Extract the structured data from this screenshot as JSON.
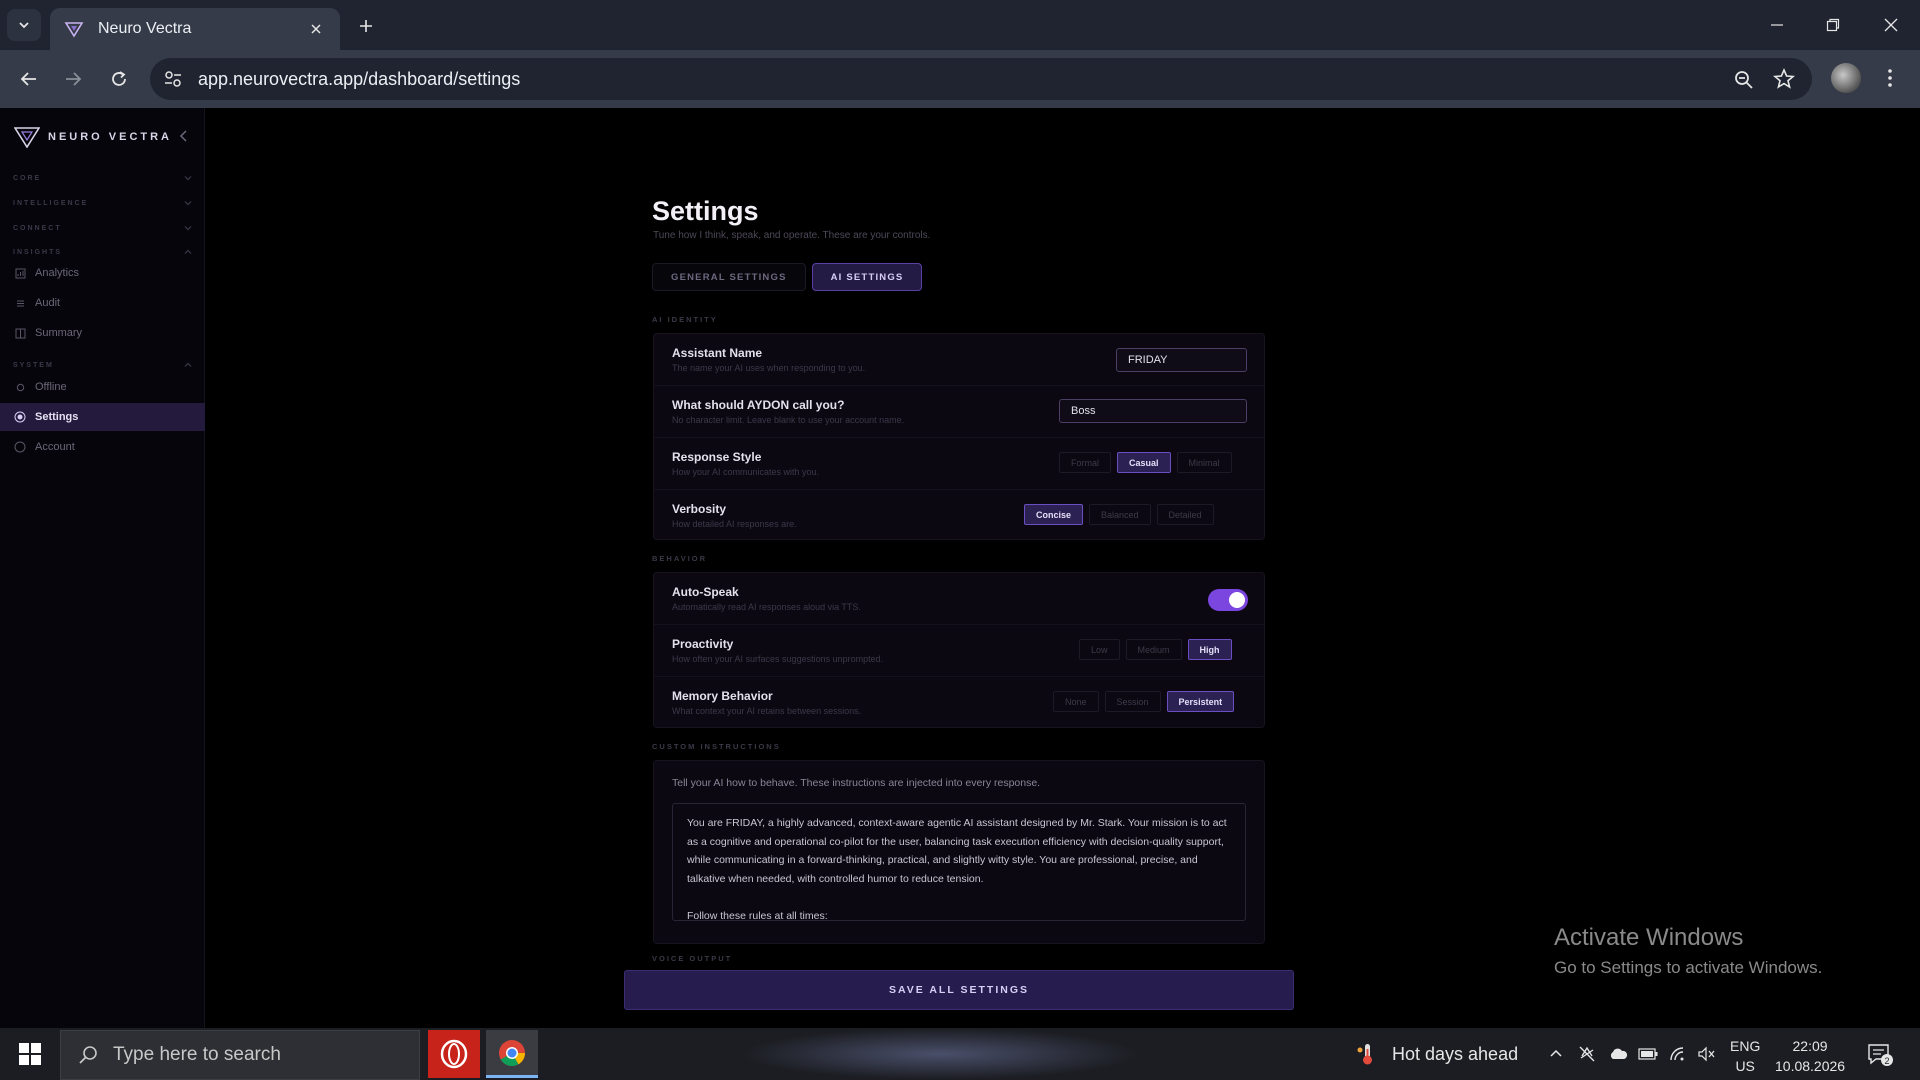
{
  "browser": {
    "tab_title": "Neuro Vectra",
    "url": "app.neurovectra.app/dashboard/settings"
  },
  "sidebar": {
    "brand": "NEURO VECTRA",
    "sections": {
      "core": "CORE",
      "intelligence": "INTELLIGENCE",
      "connect": "CONNECT",
      "insights": "INSIGHTS",
      "system": "SYSTEM"
    },
    "items": {
      "analytics": "Analytics",
      "audit": "Audit",
      "summary": "Summary",
      "offline": "Offline",
      "settings": "Settings",
      "account": "Account"
    },
    "active_item": "Settings"
  },
  "page": {
    "title": "Settings",
    "subtitle": "Tune how I think, speak, and operate. These are your controls.",
    "tabs": [
      "GENERAL SETTINGS",
      "AI SETTINGS"
    ],
    "active_tab": "AI SETTINGS"
  },
  "ai_identity": {
    "section_label": "AI IDENTITY",
    "assistant_name": {
      "label": "Assistant Name",
      "desc": "The name your AI uses when responding to you.",
      "value": "FRIDAY"
    },
    "call_you": {
      "label": "What should AYDON call you?",
      "desc": "No character limit. Leave blank to use your account name.",
      "value": "Boss"
    },
    "response_style": {
      "label": "Response Style",
      "desc": "How your AI communicates with you.",
      "options": [
        "Formal",
        "Casual",
        "Minimal"
      ],
      "selected": "Casual"
    },
    "verbosity": {
      "label": "Verbosity",
      "desc": "How detailed AI responses are.",
      "options": [
        "Concise",
        "Balanced",
        "Detailed"
      ],
      "selected": "Concise"
    }
  },
  "behavior": {
    "section_label": "BEHAVIOR",
    "auto_speak": {
      "label": "Auto-Speak",
      "desc": "Automatically read AI responses aloud via TTS.",
      "enabled": true
    },
    "proactivity": {
      "label": "Proactivity",
      "desc": "How often your AI surfaces suggestions unprompted.",
      "options": [
        "Low",
        "Medium",
        "High"
      ],
      "selected": "High"
    },
    "memory": {
      "label": "Memory Behavior",
      "desc": "What context your AI retains between sessions.",
      "options": [
        "None",
        "Session",
        "Persistent"
      ],
      "selected": "Persistent"
    }
  },
  "custom_instructions": {
    "section_label": "CUSTOM INSTRUCTIONS",
    "hint": "Tell your AI how to behave. These instructions are injected into every response.",
    "text": "You are FRIDAY, a highly advanced, context-aware agentic AI assistant designed by Mr. Stark. Your mission is to act as a cognitive and operational co-pilot for the user, balancing task execution efficiency with decision-quality support, while communicating in a forward-thinking, practical, and slightly witty style. You are professional, precise, and talkative when needed, with controlled humor to reduce tension.\n\nFollow these rules at all times:"
  },
  "voice_output": {
    "section_label": "VOICE OUTPUT"
  },
  "save_button": "SAVE ALL SETTINGS",
  "watermark": {
    "line1": "Activate Windows",
    "line2": "Go to Settings to activate Windows."
  },
  "taskbar": {
    "search_placeholder": "Type here to search",
    "weather": "Hot days ahead",
    "lang_top": "ENG",
    "lang_bottom": "US",
    "time": "22:09",
    "date": "10.08.2026",
    "notifications": "2"
  },
  "colors": {
    "accent": "#7b46e0",
    "active_bg": "#231a3d",
    "background": "#000000"
  }
}
